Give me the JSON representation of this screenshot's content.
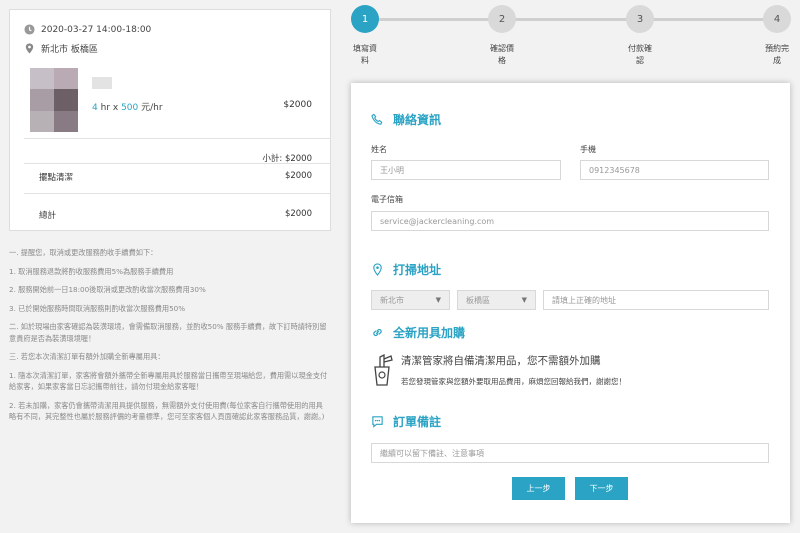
{
  "summary": {
    "datetime": "2020-03-27 14:00-18:00",
    "location": "新北市 板橋區",
    "rate": {
      "hours": "4",
      "hr_label": "hr x",
      "price": "500",
      "unit": "元/hr"
    },
    "item_price": "$2000",
    "subtotal": "小計: $2000",
    "lines": [
      {
        "label": "擺點清潔",
        "value": "$2000"
      },
      {
        "label": "總計",
        "value": "$2000"
      }
    ]
  },
  "notes": [
    "一. 提醒您，取消或更改服務酌收手續費如下：",
    "1. 取消服務退款將酌收服務費用5%為服務手續費用",
    "2. 服務開始前一日18:00後取消或更改酌收當次服務費用30%",
    "3. 已於開始服務時間取消服務則酌收當次服務費用50%",
    "二. 如於現場由家客確認為裝潢環境，會需備取消服務，並酌收50% 服務手續費，故下訂時請特別留意貴府是否為裝潢環境喔！",
    "三. 若您本次清潔訂單有額外加購全新專屬用具：",
    "1. 隨本次清潔訂單，家客將會額外攜帶全新專屬用具於服務當日攜帶至現場給您，費用需以現金支付給家客，如果家客當日忘記攜帶前往，請勿付現金給家客喔！",
    "2. 若未加購，家客仍會攜帶清潔用具提供服務，無需額外支付使用費(每位家客自行攜帶使用的用具略有不同，其完整性也屬於服務評價的考量標準，您可至家客個人頁面確認此家客服務品質，謝謝。)"
  ],
  "stepper": {
    "steps": [
      {
        "num": "1",
        "label": "填寫資料"
      },
      {
        "num": "2",
        "label": "確認價格"
      },
      {
        "num": "3",
        "label": "付款確認"
      },
      {
        "num": "4",
        "label": "預約完成"
      }
    ],
    "current_step": 1
  },
  "contact": {
    "title": "聯絡資訊",
    "name_label": "姓名",
    "name_placeholder": "王小明",
    "phone_label": "手機",
    "phone_placeholder": "0912345678",
    "email_label": "電子信箱",
    "email_placeholder": "service@jackercleaning.com"
  },
  "address": {
    "title": "打掃地址",
    "city": "新北市",
    "district": "板橋區",
    "detail_placeholder": "請填上正確的地址"
  },
  "supplies": {
    "title": "全新用具加購",
    "main": "清潔管家將自備清潔用品，您不需額外加購",
    "sub": "若您發現管家與您額外要取用品費用，麻煩您回報給我們，謝謝您！"
  },
  "remarks": {
    "title": "訂單備註",
    "placeholder": "繼續可以留下備註、注意事項"
  },
  "buttons": {
    "prev": "上一步",
    "next": "下一步"
  },
  "colors": {
    "accent": "#2aa3c4"
  }
}
